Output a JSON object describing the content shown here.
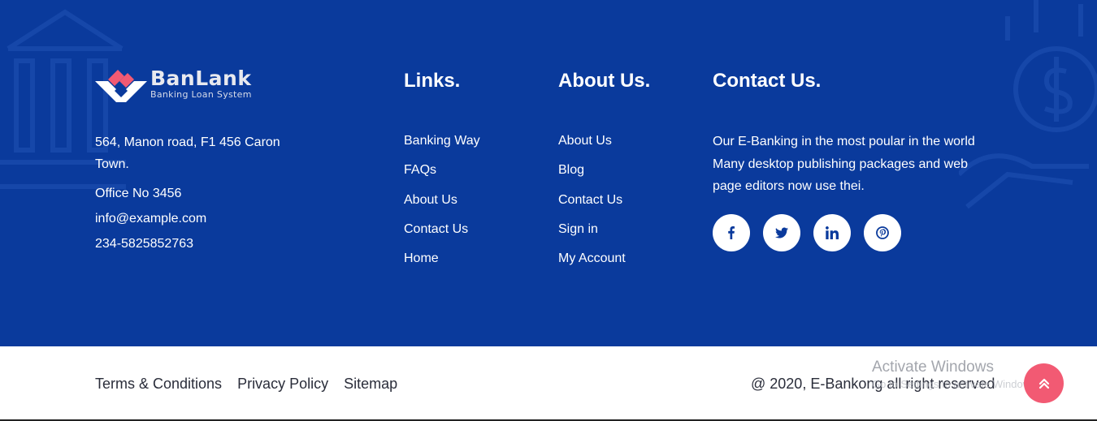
{
  "brand": {
    "name": "BanLank",
    "tagline": "Banking Loan System",
    "colors": {
      "primary": "#0a3a9c",
      "accent": "#f25a73",
      "white": "#ffffff"
    }
  },
  "contact_info": {
    "address": "564, Manon road, F1 456 Caron Town.",
    "office": "Office No 3456",
    "email": "info@example.com",
    "phone": "234-5825852763"
  },
  "links": {
    "heading": "Links.",
    "items": [
      "Banking Way",
      "FAQs",
      "About Us",
      "Contact Us",
      "Home"
    ]
  },
  "about": {
    "heading": "About Us.",
    "items": [
      "About Us",
      "Blog",
      "Contact Us",
      "Sign in",
      "My Account"
    ]
  },
  "contact_us": {
    "heading": "Contact Us.",
    "text": "Our E-Banking in the most poular in the world Many desktop publishing packages and web page editors now use thei.",
    "socials": [
      {
        "icon": "facebook-icon"
      },
      {
        "icon": "twitter-icon"
      },
      {
        "icon": "linkedin-icon"
      },
      {
        "icon": "pinterest-icon"
      }
    ]
  },
  "bottom_bar": {
    "legal_links": [
      "Terms & Conditions",
      "Privacy Policy",
      "Sitemap"
    ],
    "copyright": "@ 2020, E-Bankong all right reserved",
    "scroll_top_icon": "double-chevron-up-icon"
  },
  "os_watermark": {
    "title": "Activate Windows",
    "subtitle": "Go to Settings to activate Windows."
  }
}
